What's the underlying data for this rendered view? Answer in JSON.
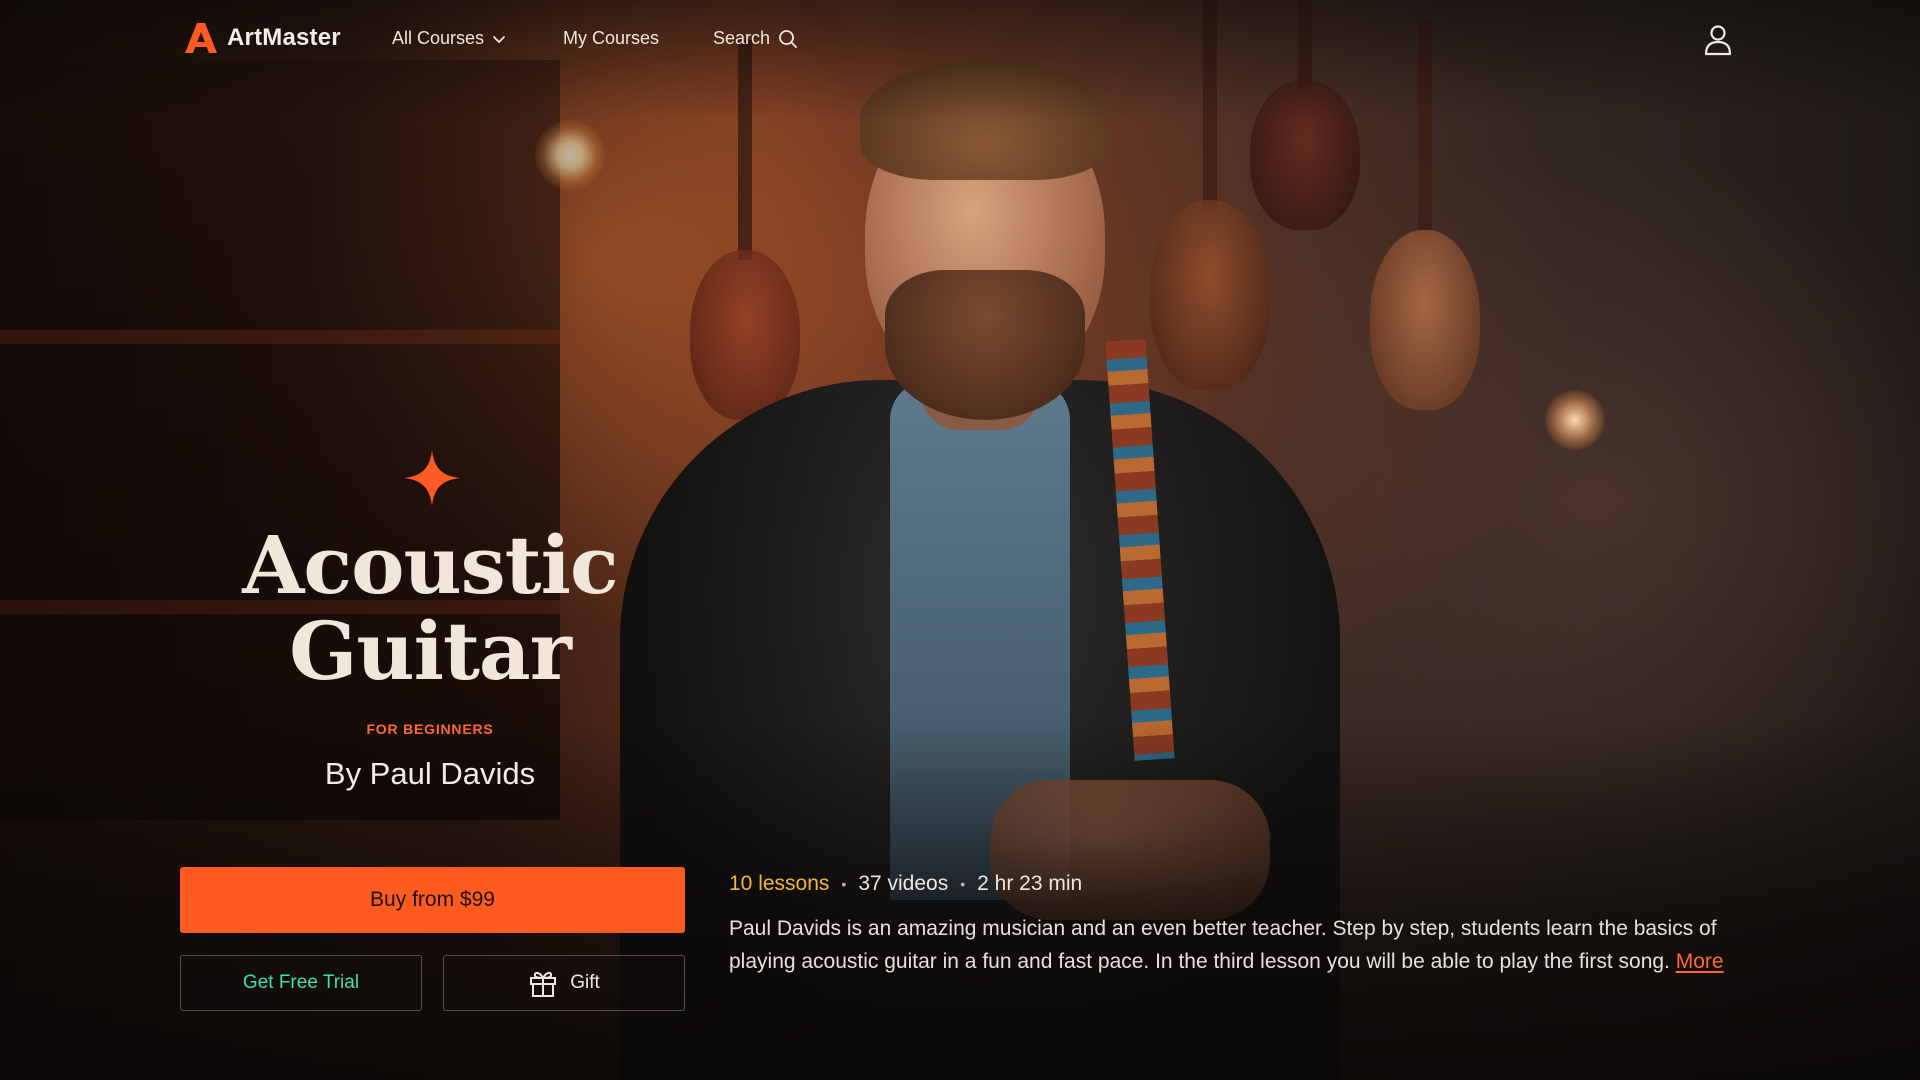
{
  "brand": {
    "name": "ArtMaster",
    "accent": "#ff5a1f"
  },
  "nav": {
    "items": [
      {
        "label": "All Courses",
        "icon": "chevron-down-icon"
      },
      {
        "label": "My Courses"
      },
      {
        "label": "Search",
        "icon": "search-icon"
      }
    ],
    "account_icon": "user-icon"
  },
  "course": {
    "title_line1": "Acoustic",
    "title_line2": "Guitar",
    "level": "FOR BEGINNERS",
    "author": "By Paul Davids",
    "meta": {
      "lessons": "10 lessons",
      "videos": "37 videos",
      "duration": "2 hr 23 min",
      "separator": "•"
    },
    "description": "Paul Davids is an amazing musician and an even better teacher. Step by step, students learn the basics of playing acoustic guitar in a fun and fast pace. In the third lesson you will be able to play the first song.",
    "more_label": "More"
  },
  "actions": {
    "buy_label": "Buy from $99",
    "trial_label": "Get Free Trial",
    "gift_label": "Gift",
    "gift_icon": "gift-icon"
  },
  "colors": {
    "trial": "#3fe0b0",
    "lessons": "#f5b43a",
    "sparkle": "#ff5a1f"
  }
}
